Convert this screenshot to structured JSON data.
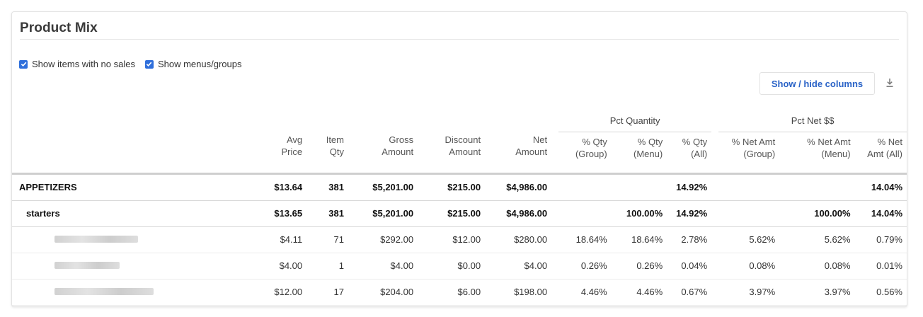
{
  "card": {
    "title": "Product Mix"
  },
  "options": [
    {
      "label": "Show items with no sales",
      "checked": true
    },
    {
      "label": "Show menus/groups",
      "checked": true
    }
  ],
  "toolbar": {
    "columns_button": "Show / hide columns",
    "download_icon": "download-icon"
  },
  "colors": {
    "accent": "#2f6fdb",
    "link": "#2a63c7"
  },
  "groups": {
    "pct_quantity": "Pct Quantity",
    "pct_net": "Pct Net $$"
  },
  "columns": [
    [
      "Avg",
      "Price"
    ],
    [
      "Item",
      "Qty"
    ],
    [
      "Gross",
      "Amount"
    ],
    [
      "Discount",
      "Amount"
    ],
    [
      "Net",
      "Amount"
    ],
    [
      "% Qty",
      "(Group)"
    ],
    [
      "% Qty",
      "(Menu)"
    ],
    [
      "% Qty",
      "(All)"
    ],
    [
      "% Net Amt",
      "(Group)"
    ],
    [
      "% Net Amt",
      "(Menu)"
    ],
    [
      "% Net",
      "Amt (All)"
    ]
  ],
  "rows": [
    {
      "level": "group",
      "name": "APPETIZERS",
      "cells": [
        "$13.64",
        "381",
        "$5,201.00",
        "$215.00",
        "$4,986.00",
        "",
        "",
        "14.92%",
        "",
        "",
        "14.04%"
      ]
    },
    {
      "level": "menu",
      "name": "starters",
      "cells": [
        "$13.65",
        "381",
        "$5,201.00",
        "$215.00",
        "$4,986.00",
        "",
        "100.00%",
        "14.92%",
        "",
        "100.00%",
        "14.04%"
      ]
    },
    {
      "level": "item",
      "name": "",
      "cells": [
        "$4.11",
        "71",
        "$292.00",
        "$12.00",
        "$280.00",
        "18.64%",
        "18.64%",
        "2.78%",
        "5.62%",
        "5.62%",
        "0.79%"
      ]
    },
    {
      "level": "item",
      "name": "",
      "cells": [
        "$4.00",
        "1",
        "$4.00",
        "$0.00",
        "$4.00",
        "0.26%",
        "0.26%",
        "0.04%",
        "0.08%",
        "0.08%",
        "0.01%"
      ]
    },
    {
      "level": "item",
      "name": "",
      "cells": [
        "$12.00",
        "17",
        "$204.00",
        "$6.00",
        "$198.00",
        "4.46%",
        "4.46%",
        "0.67%",
        "3.97%",
        "3.97%",
        "0.56%"
      ]
    }
  ]
}
